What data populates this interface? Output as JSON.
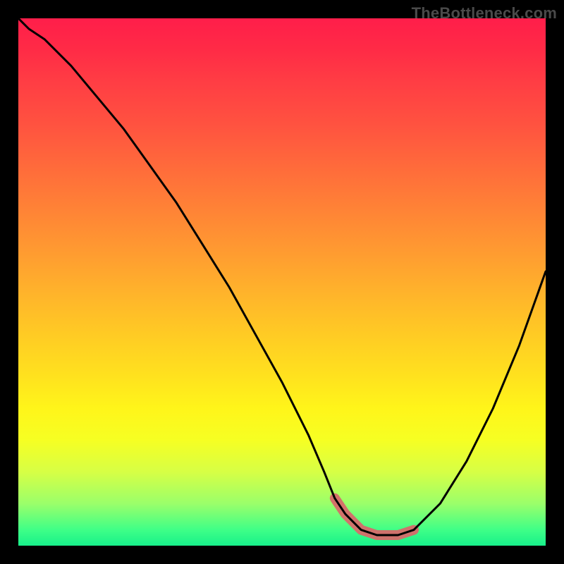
{
  "branding": {
    "watermark": "TheBottleneck.com"
  },
  "chart_data": {
    "type": "line",
    "title": "",
    "xlabel": "",
    "ylabel": "",
    "xlim": [
      0,
      100
    ],
    "ylim": [
      0,
      100
    ],
    "grid": false,
    "legend": false,
    "background_gradient": {
      "top_color": "#ff1e4a",
      "mid_color": "#ffe21e",
      "bottom_color": "#17f08a",
      "meaning": "red (high bottleneck) to green (no bottleneck)"
    },
    "series": [
      {
        "name": "bottleneck-curve",
        "color": "#000000",
        "x": [
          0,
          2,
          5,
          10,
          15,
          20,
          25,
          30,
          35,
          40,
          45,
          50,
          55,
          58,
          60,
          62,
          65,
          68,
          72,
          75,
          80,
          85,
          90,
          95,
          100
        ],
        "y": [
          100,
          98,
          96,
          91,
          85,
          79,
          72,
          65,
          57,
          49,
          40,
          31,
          21,
          14,
          9,
          6,
          3,
          2,
          2,
          3,
          8,
          16,
          26,
          38,
          52
        ]
      }
    ],
    "optimal_range": {
      "name": "highlighted-sweet-spot",
      "color": "#d76a6a",
      "x": [
        60,
        62,
        65,
        68,
        72,
        75
      ],
      "y": [
        9,
        6,
        3,
        2,
        2,
        3
      ]
    }
  }
}
